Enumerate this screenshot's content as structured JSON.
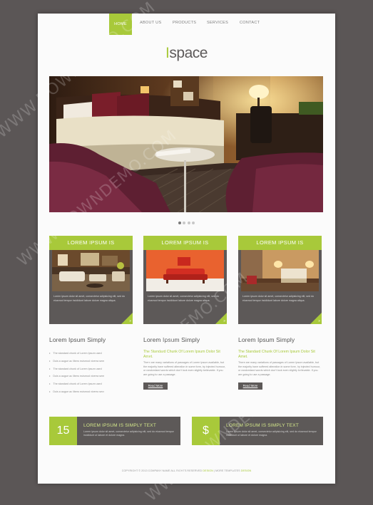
{
  "nav": {
    "items": [
      "HOME",
      "ABOUT US",
      "PRODUCTS",
      "SERVICES",
      "CONTACT"
    ]
  },
  "logo": {
    "first_letter": "I",
    "rest": "space"
  },
  "slider": {
    "dot_count": 4,
    "active": 0
  },
  "cards": [
    {
      "title": "LOREM IPSUM IS",
      "text": "Lorem ipsum dolor sit amet, consectetur adipisicing elit, sed do eiusmod tempor incididunt labore dolore magna aliqua.",
      "arrow": "»"
    },
    {
      "title": "LOREM IPSUM IS",
      "text": "Lorem ipsum dolor sit amet, consectetur adipisicing elit, sed do eiusmod tempor incididunt labore dolore magna aliqua.",
      "arrow": "»"
    },
    {
      "title": "LOREM IPSUM IS",
      "text": "Lorem ipsum dolor sit amet, consectetur adipisicing elit, sed do eiusmod tempor incididunt labore dolore magna aliqua.",
      "arrow": "»"
    }
  ],
  "columns": {
    "left": {
      "heading": "Lorem Ipsum Simply",
      "list": [
        "The standard chunk of Lorem Ipsum used",
        "Duis a augue ac libero euismod viverra sem",
        "The standard chunk of Lorem Ipsum used",
        "Duis a augue ac libero euismod viverra sem",
        "The standard chunk of Lorem Ipsum used",
        "Duis a augue ac libero euismod viverra sem"
      ]
    },
    "middle": {
      "heading": "Lorem Ipsum Simply",
      "sub": "The Standard Chunk Of Lorem Ipsum Dolor Sit Amet.",
      "body": "There are many variations of passages of Lorem Ipsum available, but the majority have suffered alteration in some form, by injected humour, or randomised words which don't look even slightly believable. If you are going to use a passage.",
      "button": "Read More"
    },
    "right": {
      "heading": "Lorem Ipsum Simply",
      "sub": "The Standard Chunk Of Lorem Ipsum Dolor Sit Amet.",
      "body": "There are many variations of passages of Lorem Ipsum available, but the majority have suffered alteration in some form, by injected humour, or randomised words which don't look even slightly believable. If you are going to use a passage.",
      "button": "Read More"
    }
  },
  "banners": [
    {
      "icon_text": "15",
      "title": "LOREM IPSUM IS SIMPLY TEXT",
      "desc": "Lorem ipsum dolor sit amet, consectetur adipisicing elit, sed do eiusmod tempor incididunt ut labore et dolore magna."
    },
    {
      "icon_text": "$",
      "title": "LOREM IPSUM IS SIMPLY TEXT",
      "desc": "Lorem ipsum dolor sit amet, consectetur adipisicing elit, sed do eiusmod tempor incididunt ut labore et dolore magna."
    }
  ],
  "footer": {
    "prefix": "COPYRIGHT © 2013 COMPANY NAME ALL RIGHTS RESERVED",
    "link1": "DESIGN",
    "middle": "MORE TEMPLATES",
    "link2": "DESIGN"
  },
  "watermark": "WWW.DOWNDEMO.COM",
  "colors": {
    "accent": "#a8c93a",
    "dark": "#5d5958",
    "background": "#5b5656",
    "page": "#fbfbfb"
  }
}
